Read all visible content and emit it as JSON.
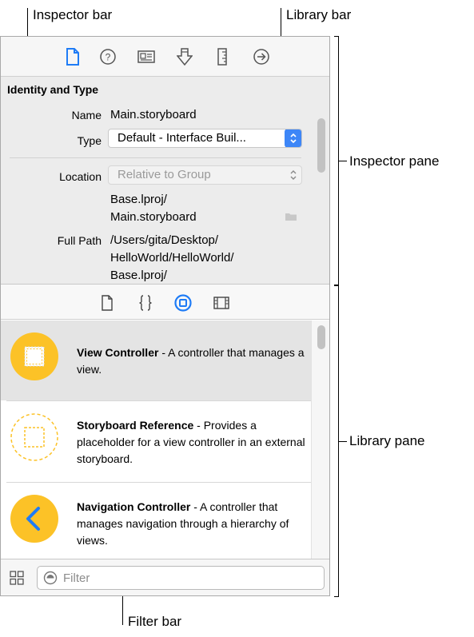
{
  "callouts": {
    "inspector_bar": "Inspector bar",
    "library_bar": "Library bar",
    "inspector_pane": "Inspector pane",
    "library_pane": "Library pane",
    "filter_bar": "Filter bar"
  },
  "inspector_bar": {
    "tabs": [
      "file-inspector-icon",
      "quick-help-icon",
      "identity-inspector-icon",
      "attributes-inspector-icon",
      "size-inspector-icon",
      "connections-inspector-icon"
    ],
    "selected_tab": "file-inspector-icon",
    "accent_color": "#1f7cf6"
  },
  "inspector_pane": {
    "section_title": "Identity and Type",
    "name_label": "Name",
    "name_value": "Main.storyboard",
    "type_label": "Type",
    "type_value": "Default - Interface Buil...",
    "location_label": "Location",
    "location_value": "Relative to Group",
    "location_path_line1": "Base.lproj/",
    "location_path_line2": "Main.storyboard",
    "full_path_label": "Full Path",
    "full_path_line1": "/Users/gita/Desktop/",
    "full_path_line2": "HelloWorld/HelloWorld/",
    "full_path_line3": "Base.lproj/"
  },
  "library_bar": {
    "tabs": [
      "file-template-icon",
      "code-snippet-icon",
      "object-library-icon",
      "media-library-icon"
    ],
    "selected_tab": "object-library-icon"
  },
  "library_pane": {
    "items": [
      {
        "title": "View Controller",
        "description": " - A controller that manages a view.",
        "icon": "view-controller-icon"
      },
      {
        "title": "Storyboard Reference",
        "description": " - Provides a placeholder for a view controller in an external storyboard.",
        "icon": "storyboard-reference-icon"
      },
      {
        "title": "Navigation Controller",
        "description": " - A controller that manages navigation through a hierarchy of views.",
        "icon": "navigation-controller-icon"
      }
    ],
    "icon_color": "#fcc227"
  },
  "filter_bar": {
    "placeholder": "Filter",
    "view_toggle_icon": "grid-icon"
  }
}
